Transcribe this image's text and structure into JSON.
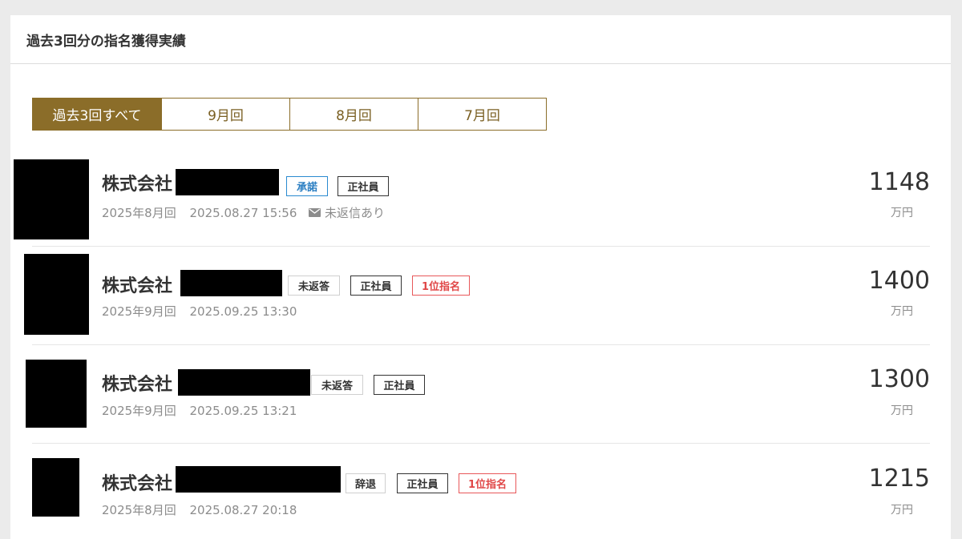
{
  "header": {
    "title": "過去3回分の指名獲得実績"
  },
  "tabs": [
    {
      "label": "過去3回すべて",
      "active": true
    },
    {
      "label": "9月回",
      "active": false
    },
    {
      "label": "8月回",
      "active": false
    },
    {
      "label": "7月回",
      "active": false
    }
  ],
  "offers": [
    {
      "company_prefix": "株式会社",
      "badges": {
        "status": "承諾",
        "employment": "正社員"
      },
      "round": "2025年8月回",
      "datetime": "2025.08.27 15:56",
      "unreplied_label": "未返信あり",
      "unreplied_icon": "mail-icon",
      "salary": "1148",
      "unit": "万円"
    },
    {
      "company_prefix": "株式会社",
      "badges": {
        "status": "未返答",
        "employment": "正社員",
        "rank": "1位指名"
      },
      "round": "2025年9月回",
      "datetime": "2025.09.25 13:30",
      "salary": "1400",
      "unit": "万円"
    },
    {
      "company_prefix": "株式会社",
      "badges": {
        "status": "未返答",
        "employment": "正社員"
      },
      "round": "2025年9月回",
      "datetime": "2025.09.25 13:21",
      "salary": "1300",
      "unit": "万円"
    },
    {
      "company_prefix": "株式会社",
      "badges": {
        "status": "辞退",
        "employment": "正社員",
        "rank": "1位指名"
      },
      "round": "2025年8月回",
      "datetime": "2025.08.27 20:18",
      "salary": "1215",
      "unit": "万円"
    }
  ],
  "colors": {
    "accent": "#8b6d29",
    "accept_blue": "#2a7ec2",
    "rank_red": "#e04848"
  }
}
